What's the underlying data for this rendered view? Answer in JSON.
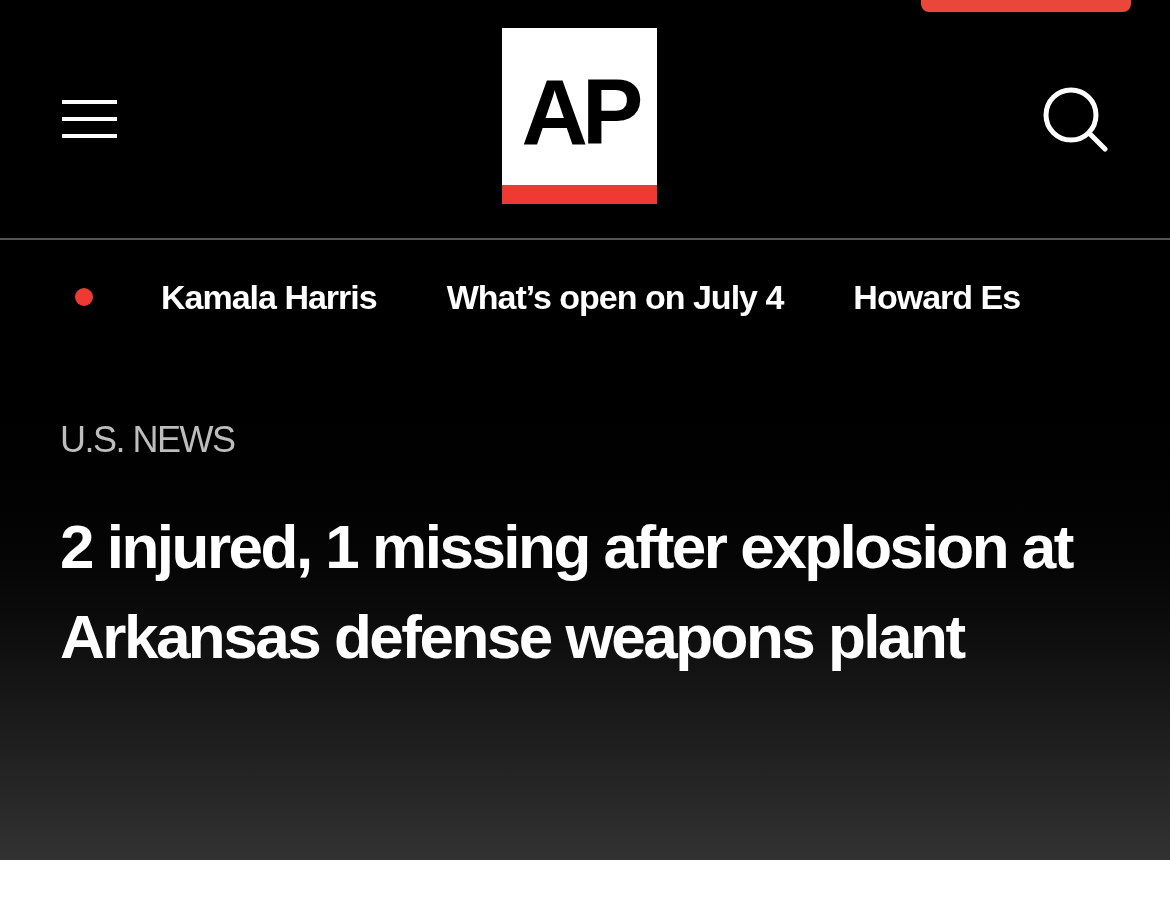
{
  "logo": "AP",
  "trending_links": [
    "Kamala Harris",
    "What’s open on July 4",
    "Howard Es"
  ],
  "section": "U.S. NEWS",
  "headline": "2 injured, 1 missing after explosion at Arkansas defense weapons plant"
}
